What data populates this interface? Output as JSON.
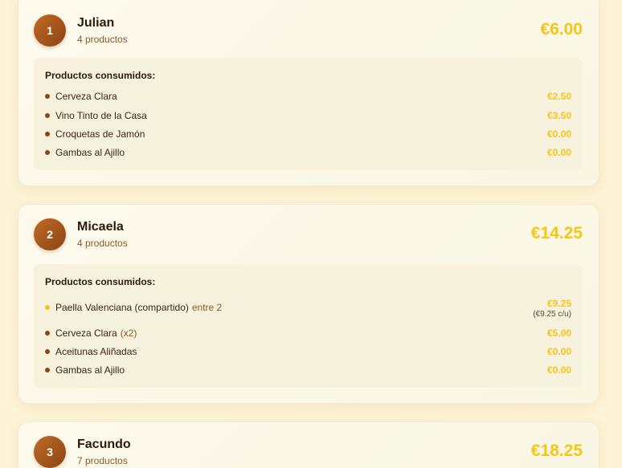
{
  "section_label": "Productos consumidos:",
  "people": [
    {
      "number": "1",
      "name": "Julian",
      "count": "4 productos",
      "total": "€6.00",
      "items": [
        {
          "name": "Cerveza Clara",
          "extra": "",
          "price": "€2.50",
          "price_sub": "",
          "shared": false
        },
        {
          "name": "Vino Tinto de la Casa",
          "extra": "",
          "price": "€3.50",
          "price_sub": "",
          "shared": false
        },
        {
          "name": "Croquetas de Jamón",
          "extra": "",
          "price": "€0.00",
          "price_sub": "",
          "shared": false
        },
        {
          "name": "Gambas al Ajillo",
          "extra": "",
          "price": "€0.00",
          "price_sub": "",
          "shared": false
        }
      ]
    },
    {
      "number": "2",
      "name": "Micaela",
      "count": "4 productos",
      "total": "€14.25",
      "items": [
        {
          "name": "Paella Valenciana (compartido)",
          "extra": "entre 2",
          "price": "€9.25",
          "price_sub": "(€9.25 c/u)",
          "shared": true
        },
        {
          "name": "Cerveza Clara",
          "extra": "(x2)",
          "price": "€5.00",
          "price_sub": "",
          "shared": false
        },
        {
          "name": "Aceitunas Aliñadas",
          "extra": "",
          "price": "€0.00",
          "price_sub": "",
          "shared": false
        },
        {
          "name": "Gambas al Ajillo",
          "extra": "",
          "price": "€0.00",
          "price_sub": "",
          "shared": false
        }
      ]
    },
    {
      "number": "3",
      "name": "Facundo",
      "count": "7 productos",
      "total": "€18.25",
      "items": []
    }
  ],
  "colors": {
    "accent_gold": "#f5c518",
    "badge_brown": "#8b4513",
    "background": "#fdf3d6"
  }
}
